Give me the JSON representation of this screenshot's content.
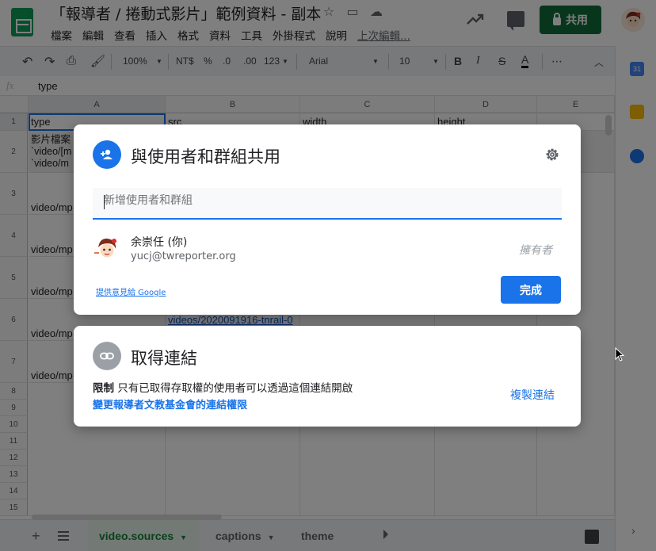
{
  "app": {
    "doc_title": "「報導者 / 捲動式影片」範例資料 - 副本",
    "menu": [
      "檔案",
      "編輯",
      "查看",
      "插入",
      "格式",
      "資料",
      "工具",
      "外掛程式",
      "說明"
    ],
    "last_edit": "上次編輯...",
    "share_label": "共用",
    "brand_color": "#0f9d58"
  },
  "toolbar": {
    "zoom": "100%",
    "currency": "NT$",
    "percent": "%",
    "dec_decrease": ".0",
    "dec_increase": ".00",
    "format_more": "123",
    "font": "Arial",
    "font_size": "10",
    "bold": "B",
    "italic": "I",
    "strike": "S",
    "text_color": "A",
    "more": "⋯"
  },
  "formula_bar": {
    "fx": "fx",
    "value": "type"
  },
  "grid": {
    "columns": [
      "A",
      "B",
      "C",
      "D",
      "E"
    ],
    "rows": [
      "1",
      "2",
      "3",
      "4",
      "5",
      "6",
      "7",
      "8",
      "9",
      "10",
      "11",
      "12",
      "13",
      "14",
      "15"
    ],
    "cells": {
      "a1": "type",
      "b1": "src",
      "c1": "width",
      "d1": "height",
      "a2_line1": "影片檔案",
      "a2_line2": "`video/[m",
      "a2_line3": "`video/m",
      "a3": "video/mp",
      "a4": "video/mp",
      "a5": "video/mp",
      "a6": "video/mp",
      "a7": "video/mp",
      "b6": "videos/2020091916-tnrail-0"
    }
  },
  "sheets": {
    "tabs": [
      "video.sources",
      "captions",
      "theme"
    ],
    "active": "video.sources"
  },
  "share_dialog": {
    "title": "與使用者和群組共用",
    "input_placeholder": "新增使用者和群組",
    "user": {
      "name": "余崇任 (你)",
      "email": "yucj@twreporter.org",
      "role": "擁有者"
    },
    "feedback": "提供意見給 Google",
    "done": "完成"
  },
  "link_dialog": {
    "title": "取得連結",
    "restriction_label": "限制",
    "restriction_text": "只有已取得存取權的使用者可以透過這個連結開啟",
    "change_link": "變更報導者文教基金會的連結權限",
    "copy_link": "複製連結"
  }
}
